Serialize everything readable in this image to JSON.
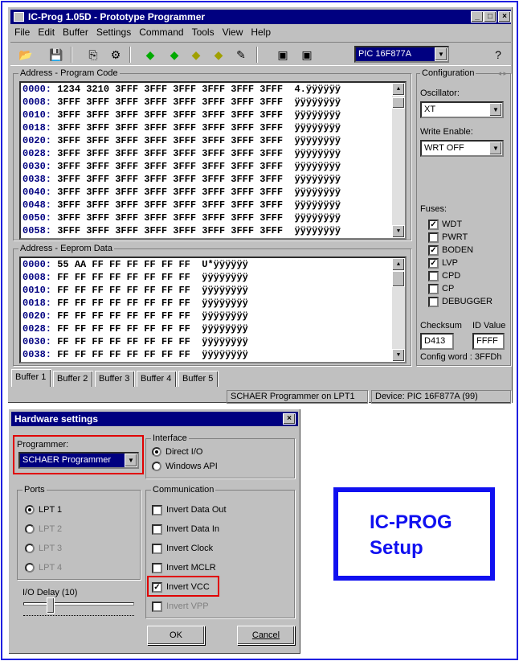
{
  "window": {
    "title": "IC-Prog 1.05D - Prototype Programmer"
  },
  "menu": [
    "File",
    "Edit",
    "Buffer",
    "Settings",
    "Command",
    "Tools",
    "View",
    "Help"
  ],
  "toolbar": {
    "device": "PIC 16F877A"
  },
  "program": {
    "label": "Address - Program Code",
    "rows": [
      [
        "0000:",
        "1234 3210 3FFF 3FFF 3FFF 3FFF 3FFF 3FFF",
        "4.ÿÿÿÿÿÿ"
      ],
      [
        "0008:",
        "3FFF 3FFF 3FFF 3FFF 3FFF 3FFF 3FFF 3FFF",
        "ÿÿÿÿÿÿÿÿ"
      ],
      [
        "0010:",
        "3FFF 3FFF 3FFF 3FFF 3FFF 3FFF 3FFF 3FFF",
        "ÿÿÿÿÿÿÿÿ"
      ],
      [
        "0018:",
        "3FFF 3FFF 3FFF 3FFF 3FFF 3FFF 3FFF 3FFF",
        "ÿÿÿÿÿÿÿÿ"
      ],
      [
        "0020:",
        "3FFF 3FFF 3FFF 3FFF 3FFF 3FFF 3FFF 3FFF",
        "ÿÿÿÿÿÿÿÿ"
      ],
      [
        "0028:",
        "3FFF 3FFF 3FFF 3FFF 3FFF 3FFF 3FFF 3FFF",
        "ÿÿÿÿÿÿÿÿ"
      ],
      [
        "0030:",
        "3FFF 3FFF 3FFF 3FFF 3FFF 3FFF 3FFF 3FFF",
        "ÿÿÿÿÿÿÿÿ"
      ],
      [
        "0038:",
        "3FFF 3FFF 3FFF 3FFF 3FFF 3FFF 3FFF 3FFF",
        "ÿÿÿÿÿÿÿÿ"
      ],
      [
        "0040:",
        "3FFF 3FFF 3FFF 3FFF 3FFF 3FFF 3FFF 3FFF",
        "ÿÿÿÿÿÿÿÿ"
      ],
      [
        "0048:",
        "3FFF 3FFF 3FFF 3FFF 3FFF 3FFF 3FFF 3FFF",
        "ÿÿÿÿÿÿÿÿ"
      ],
      [
        "0050:",
        "3FFF 3FFF 3FFF 3FFF 3FFF 3FFF 3FFF 3FFF",
        "ÿÿÿÿÿÿÿÿ"
      ],
      [
        "0058:",
        "3FFF 3FFF 3FFF 3FFF 3FFF 3FFF 3FFF 3FFF",
        "ÿÿÿÿÿÿÿÿ"
      ]
    ]
  },
  "eeprom": {
    "label": "Address - Eeprom Data",
    "rows": [
      [
        "0000:",
        "55 AA FF FF FF FF FF FF",
        "U*ÿÿÿÿÿÿ"
      ],
      [
        "0008:",
        "FF FF FF FF FF FF FF FF",
        "ÿÿÿÿÿÿÿÿ"
      ],
      [
        "0010:",
        "FF FF FF FF FF FF FF FF",
        "ÿÿÿÿÿÿÿÿ"
      ],
      [
        "0018:",
        "FF FF FF FF FF FF FF FF",
        "ÿÿÿÿÿÿÿÿ"
      ],
      [
        "0020:",
        "FF FF FF FF FF FF FF FF",
        "ÿÿÿÿÿÿÿÿ"
      ],
      [
        "0028:",
        "FF FF FF FF FF FF FF FF",
        "ÿÿÿÿÿÿÿÿ"
      ],
      [
        "0030:",
        "FF FF FF FF FF FF FF FF",
        "ÿÿÿÿÿÿÿÿ"
      ],
      [
        "0038:",
        "FF FF FF FF FF FF FF FF",
        "ÿÿÿÿÿÿÿÿ"
      ]
    ]
  },
  "config": {
    "label": "Configuration",
    "osc_label": "Oscillator:",
    "osc": "XT",
    "we_label": "Write Enable:",
    "we": "WRT OFF",
    "fuses_label": "Fuses:",
    "fuses": [
      {
        "name": "WDT",
        "on": true
      },
      {
        "name": "PWRT",
        "on": false
      },
      {
        "name": "BODEN",
        "on": true
      },
      {
        "name": "LVP",
        "on": true
      },
      {
        "name": "CPD",
        "on": false
      },
      {
        "name": "CP",
        "on": false
      },
      {
        "name": "DEBUGGER",
        "on": false
      }
    ],
    "checksum_label": "Checksum",
    "checksum": "D413",
    "id_label": "ID Value",
    "id": "FFFF",
    "config_word": "Config word : 3FFDh"
  },
  "tabs": [
    "Buffer 1",
    "Buffer 2",
    "Buffer 3",
    "Buffer 4",
    "Buffer 5"
  ],
  "status": {
    "programmer": "SCHAER Programmer on LPT1",
    "device": "Device: PIC 16F877A   (99)"
  },
  "dialog": {
    "title": "Hardware settings",
    "programmer_label": "Programmer:",
    "programmer": "SCHAER Programmer",
    "interface_label": "Interface",
    "direct_io": "Direct I/O",
    "windows_api": "Windows API",
    "ports_label": "Ports",
    "ports": [
      "LPT 1",
      "LPT 2",
      "LPT 3",
      "LPT 4"
    ],
    "comm_label": "Communication",
    "comm": [
      "Invert Data Out",
      "Invert Data In",
      "Invert Clock",
      "Invert MCLR",
      "Invert VCC",
      "Invert VPP"
    ],
    "delay_label": "I/O Delay (10)",
    "ok": "OK",
    "cancel": "Cancel"
  },
  "banner": {
    "line1": "IC-PROG",
    "line2": "Setup"
  }
}
